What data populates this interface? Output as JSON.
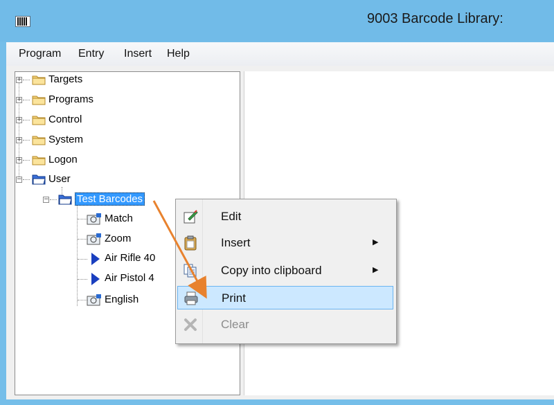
{
  "window": {
    "title": "9003 Barcode Library:"
  },
  "menubar": {
    "items": [
      "Program",
      "Entry",
      "Insert",
      "Help"
    ]
  },
  "tree": {
    "nodes": [
      {
        "label": "Targets",
        "icon": "folder-icon"
      },
      {
        "label": "Programs",
        "icon": "folder-icon"
      },
      {
        "label": "Control",
        "icon": "folder-icon"
      },
      {
        "label": "System",
        "icon": "folder-icon"
      },
      {
        "label": "Logon",
        "icon": "folder-icon"
      },
      {
        "label": "User",
        "icon": "folder-open-icon"
      },
      {
        "label": "Test Barcodes",
        "icon": "folder-open-icon",
        "selected": true
      },
      {
        "label": "Match",
        "icon": "target-icon"
      },
      {
        "label": "Zoom",
        "icon": "target-icon"
      },
      {
        "label": "Air Rifle 40",
        "icon": "play-icon"
      },
      {
        "label": "Air Pistol 4",
        "icon": "play-icon"
      },
      {
        "label": "English",
        "icon": "target-icon"
      }
    ]
  },
  "context_menu": {
    "items": [
      {
        "label": "Edit",
        "icon": "edit-icon"
      },
      {
        "label": "Insert",
        "icon": "clipboard-icon",
        "submenu": true
      },
      {
        "label": "Copy into clipboard",
        "icon": "copy-icon",
        "submenu": true
      },
      {
        "label": "Print",
        "icon": "printer-icon",
        "highlighted": true
      },
      {
        "label": "Clear",
        "icon": "delete-icon",
        "disabled": true
      }
    ],
    "submenu_arrow": "▶"
  },
  "colors": {
    "titlebar": "#71bbe8",
    "selection": "#3399ff",
    "menu_highlight": "#cce8ff",
    "annotation_arrow": "#e8822e"
  }
}
